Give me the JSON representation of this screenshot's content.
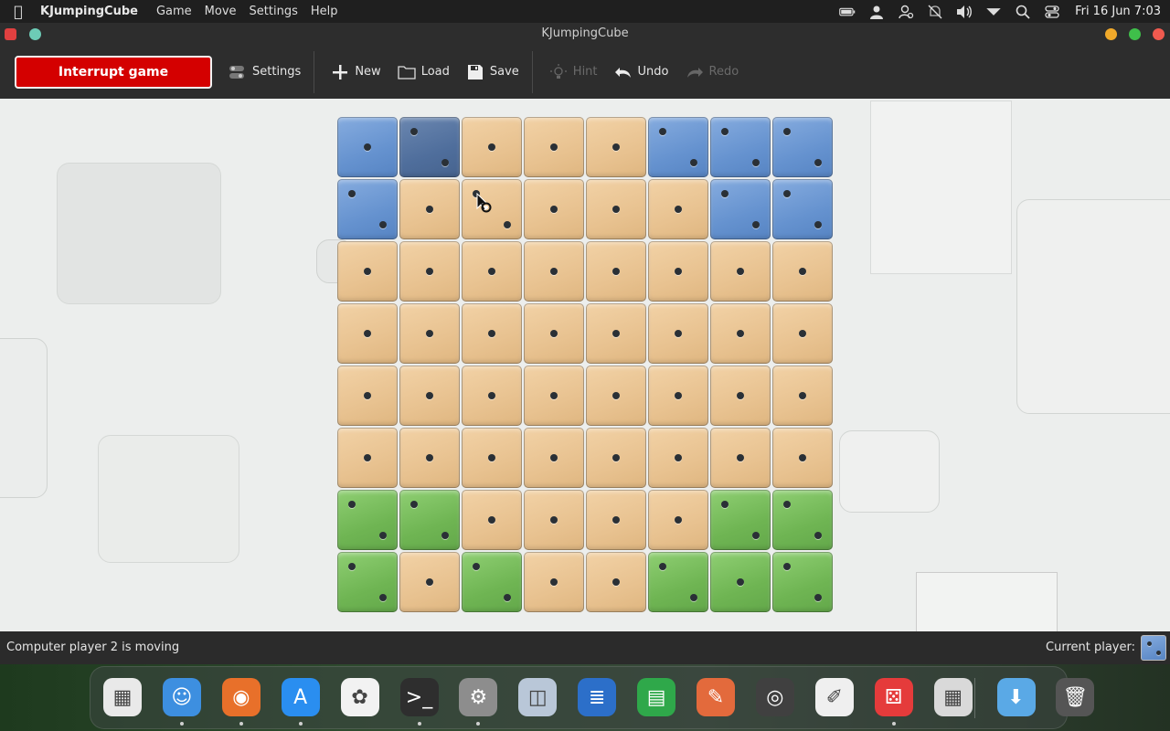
{
  "menubar": {
    "app_name": "KJumpingCube",
    "menus": [
      "Game",
      "Move",
      "Settings",
      "Help"
    ],
    "clock": "Fri 16 Jun  7:03"
  },
  "window": {
    "title": "KJumpingCube"
  },
  "toolbar": {
    "interrupt_label": "Interrupt game",
    "settings_label": "Settings",
    "new_label": "New",
    "load_label": "Load",
    "save_label": "Save",
    "hint_label": "Hint",
    "undo_label": "Undo",
    "redo_label": "Redo"
  },
  "board": {
    "size": 8,
    "owners": [
      [
        "b",
        "bd",
        "n",
        "n",
        "n",
        "b",
        "b",
        "b"
      ],
      [
        "b",
        "n",
        "n",
        "n",
        "n",
        "n",
        "b",
        "b"
      ],
      [
        "n",
        "n",
        "n",
        "n",
        "n",
        "n",
        "n",
        "n"
      ],
      [
        "n",
        "n",
        "n",
        "n",
        "n",
        "n",
        "n",
        "n"
      ],
      [
        "n",
        "n",
        "n",
        "n",
        "n",
        "n",
        "n",
        "n"
      ],
      [
        "n",
        "n",
        "n",
        "n",
        "n",
        "n",
        "n",
        "n"
      ],
      [
        "g",
        "g",
        "n",
        "n",
        "n",
        "n",
        "g",
        "g"
      ],
      [
        "g",
        "n",
        "g",
        "n",
        "n",
        "g",
        "g",
        "g"
      ]
    ],
    "pips": [
      [
        1,
        2,
        1,
        1,
        1,
        2,
        2,
        2
      ],
      [
        2,
        1,
        2,
        1,
        1,
        1,
        2,
        2
      ],
      [
        1,
        1,
        1,
        1,
        1,
        1,
        1,
        1
      ],
      [
        1,
        1,
        1,
        1,
        1,
        1,
        1,
        1
      ],
      [
        1,
        1,
        1,
        1,
        1,
        1,
        1,
        1
      ],
      [
        1,
        1,
        1,
        1,
        1,
        1,
        1,
        1
      ],
      [
        2,
        2,
        1,
        1,
        1,
        1,
        2,
        2
      ],
      [
        2,
        1,
        2,
        1,
        1,
        2,
        1,
        2
      ]
    ],
    "colors": {
      "neutral": "#e8c290",
      "player1_blue": "#6592cf",
      "player1_blue_active": "#4f6e9c",
      "player2_green": "#6fb553"
    }
  },
  "status": {
    "message": "Computer player 2 is moving",
    "current_player_label": "Current player:"
  },
  "dock": {
    "items": [
      {
        "name": "launchpad-icon",
        "glyph": "▦",
        "color": "#e9e9e9",
        "running": false
      },
      {
        "name": "finder-icon",
        "glyph": "☺",
        "color": "#3d8fe0",
        "running": true
      },
      {
        "name": "firefox-icon",
        "glyph": "◉",
        "color": "#e8702a",
        "running": true
      },
      {
        "name": "app-store-icon",
        "glyph": "A",
        "color": "#2a8ef0",
        "running": true
      },
      {
        "name": "photos-icon",
        "glyph": "✿",
        "color": "#f2f2f2",
        "running": false
      },
      {
        "name": "terminal-icon",
        "glyph": ">_",
        "color": "#2e2e2e",
        "running": true
      },
      {
        "name": "system-settings-icon",
        "glyph": "⚙",
        "color": "#8d8d8d",
        "running": true
      },
      {
        "name": "screenshot-icon",
        "glyph": "◫",
        "color": "#b9c7d8",
        "running": false
      },
      {
        "name": "writer-icon",
        "glyph": "≣",
        "color": "#2c6fc9",
        "running": false
      },
      {
        "name": "calc-icon",
        "glyph": "▤",
        "color": "#2fa84a",
        "running": false
      },
      {
        "name": "draw-icon",
        "glyph": "✎",
        "color": "#e36a3c",
        "running": false
      },
      {
        "name": "tape-icon",
        "glyph": "◎",
        "color": "#404040",
        "running": false
      },
      {
        "name": "text-editor-icon",
        "glyph": "✐",
        "color": "#efefef",
        "running": false
      },
      {
        "name": "kjumpingcube-icon",
        "glyph": "⚄",
        "color": "#e53b3b",
        "running": true
      },
      {
        "name": "calculator-icon",
        "glyph": "▦",
        "color": "#d9d9d9",
        "running": false
      },
      {
        "name": "downloads-folder-icon",
        "glyph": "⬇",
        "color": "#5aa9e6",
        "running": false
      },
      {
        "name": "trash-icon",
        "glyph": "🗑",
        "color": "#555555",
        "running": false
      }
    ]
  }
}
